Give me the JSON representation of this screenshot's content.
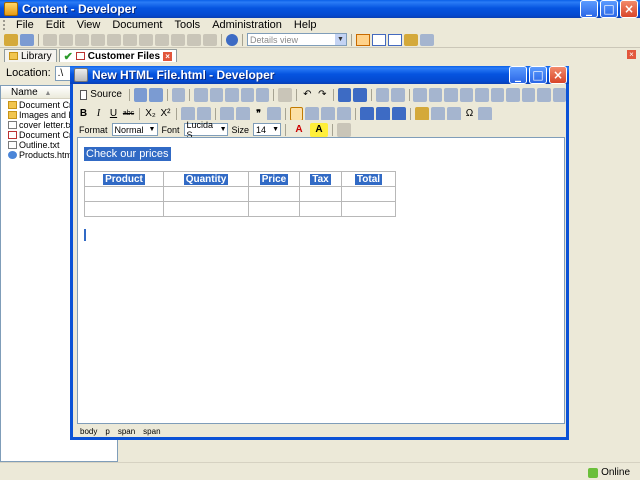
{
  "app": {
    "title": "Content - Developer",
    "menus": [
      "File",
      "Edit",
      "View",
      "Document",
      "Tools",
      "Administration",
      "Help"
    ],
    "view_select": "Details view"
  },
  "tabs": [
    {
      "label": "Library",
      "active": false
    },
    {
      "label": "Customer Files",
      "active": true
    }
  ],
  "location": {
    "label": "Location:",
    "value": ".\\"
  },
  "files": {
    "header": "Name",
    "items": [
      {
        "name": "Document Creatio",
        "kind": "folder"
      },
      {
        "name": "Images and Logo",
        "kind": "folder"
      },
      {
        "name": "cover letter.txt",
        "kind": "txt"
      },
      {
        "name": "Document Creatio",
        "kind": "doc"
      },
      {
        "name": "Outline.txt",
        "kind": "txt"
      },
      {
        "name": "Products.html",
        "kind": "html"
      }
    ]
  },
  "editor": {
    "title": "New HTML File.html - Developer",
    "source_label": "Source",
    "format_label": "Format",
    "format_value": "Normal",
    "font_label": "Font",
    "font_value": "Lucida S...",
    "size_label": "Size",
    "size_value": "14",
    "bold": "B",
    "italic": "I",
    "underline": "U",
    "strike": "abc",
    "subscript": "X₂",
    "superscript": "X²",
    "heading": "Check our prices",
    "table_headers": [
      "Product",
      "Quantity",
      "Price",
      "Tax",
      "Total"
    ],
    "path": [
      "body",
      "p",
      "span",
      "span"
    ]
  },
  "status": {
    "online": "Online"
  }
}
